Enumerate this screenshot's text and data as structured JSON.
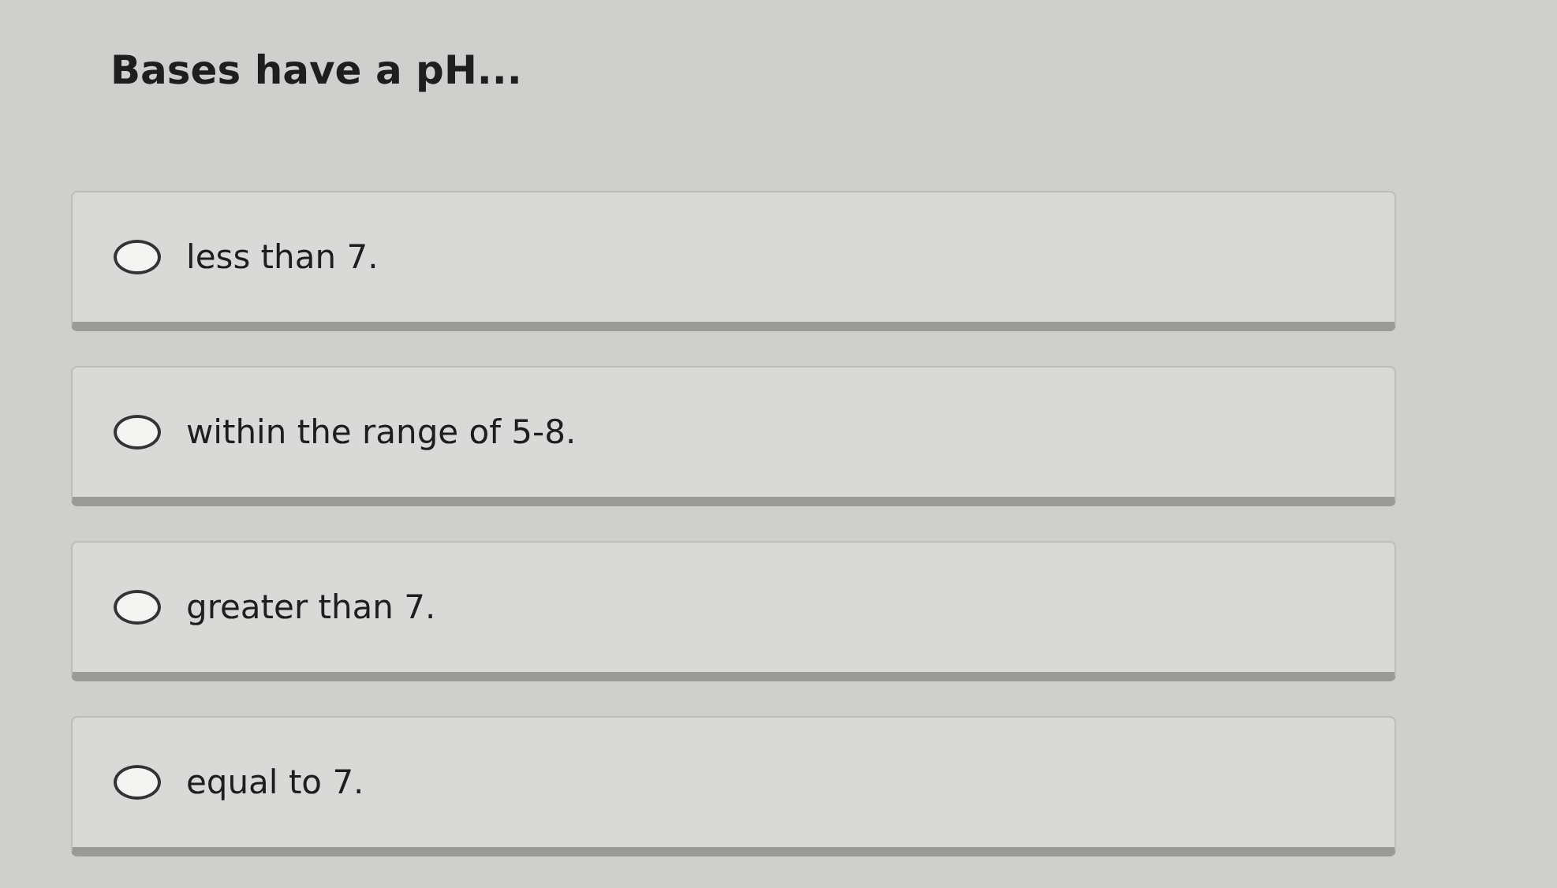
{
  "question": "Bases have a pH...",
  "options": [
    {
      "label": "less than 7.",
      "selected": false
    },
    {
      "label": "within the range of 5-8.",
      "selected": false
    },
    {
      "label": "greater than 7.",
      "selected": false
    },
    {
      "label": "equal to 7.",
      "selected": false
    }
  ]
}
